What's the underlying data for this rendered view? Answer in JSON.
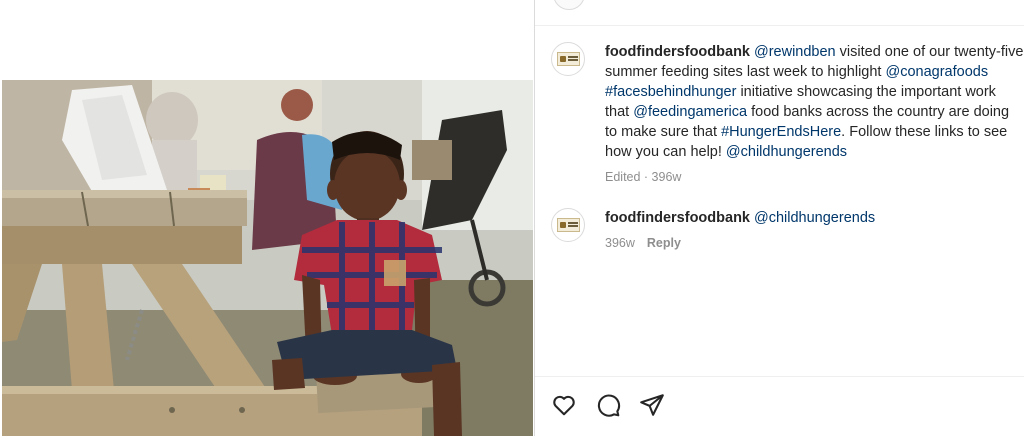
{
  "post": {
    "caption": {
      "username": "foodfindersfoodbank",
      "lines": [
        [
          {
            "t": "mention",
            "v": "@rewindben"
          },
          {
            "t": "text",
            "v": " visited one of our twenty-five"
          }
        ],
        [
          {
            "t": "text",
            "v": "summer feeding sites last week to highlight "
          },
          {
            "t": "mention",
            "v": "@conagrafoods"
          }
        ],
        [
          {
            "t": "mention",
            "v": "#facesbehindhunger"
          },
          {
            "t": "text",
            "v": " initiative showcasing the important work"
          }
        ],
        [
          {
            "t": "text",
            "v": "that "
          },
          {
            "t": "mention",
            "v": "@feedingamerica"
          },
          {
            "t": "text",
            "v": " food banks across the country are doing"
          }
        ],
        [
          {
            "t": "text",
            "v": "to make sure that "
          },
          {
            "t": "mention",
            "v": "#HungerEndsHere"
          },
          {
            "t": "text",
            "v": ". Follow these links to see"
          }
        ],
        [
          {
            "t": "text",
            "v": "how you can help! "
          },
          {
            "t": "mention",
            "v": "@childhungerends"
          }
        ]
      ],
      "meta": "Edited · 396w"
    },
    "comment": {
      "username": "foodfindersfoodbank",
      "mention": "@childhungerends",
      "time": "396w",
      "reply_label": "Reply"
    }
  },
  "icons": [
    "heart-icon",
    "comment-icon",
    "share-icon"
  ],
  "colors": {
    "link": "#00376b",
    "text": "#262626",
    "muted": "#8e8e8e",
    "border": "#dbdbdb"
  }
}
